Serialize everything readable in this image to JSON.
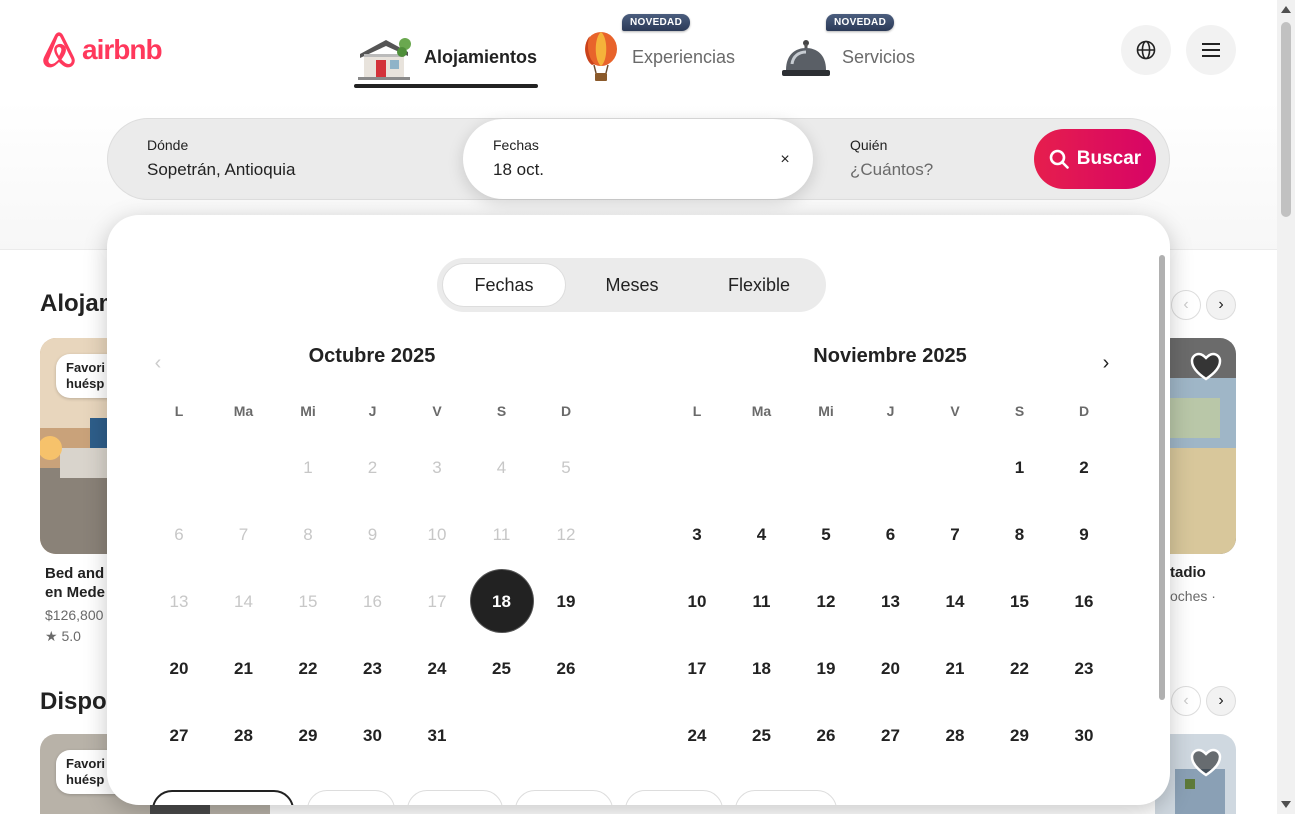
{
  "brand": {
    "name": "airbnb",
    "color": "#FF385C"
  },
  "nav": {
    "items": [
      {
        "label": "Alojamientos",
        "icon": "house-icon",
        "active": true
      },
      {
        "label": "Experiencias",
        "icon": "hot-air-balloon-icon",
        "badge": "NOVEDAD"
      },
      {
        "label": "Servicios",
        "icon": "service-bell-icon",
        "badge": "NOVEDAD"
      }
    ]
  },
  "header_actions": {
    "globe": "globe-icon",
    "menu": "hamburger-menu-icon"
  },
  "search": {
    "where_label": "Dónde",
    "where_value": "Sopetrán, Antioquia",
    "dates_label": "Fechas",
    "dates_value": "18 oct.",
    "clear": "×",
    "who_label": "Quién",
    "who_placeholder": "¿Cuántos?",
    "button_label": "Buscar",
    "button_color": "#E61E4D"
  },
  "background": {
    "section1_title": "Alojam",
    "section2_title": "Dispor",
    "card1": {
      "badge_line1": "Favori",
      "badge_line2": "huésp",
      "title_line1": "Bed and",
      "title_line2": "en Mede",
      "price": "$126,800",
      "rating": "★ 5.0"
    },
    "card2": {
      "badge_line1": "Favori",
      "badge_line2": "huésp"
    },
    "right_card": {
      "title": "tadio",
      "subtitle": "oches ·"
    }
  },
  "calendar": {
    "tabs": [
      "Fechas",
      "Meses",
      "Flexible"
    ],
    "active_tab": 0,
    "weekdays": [
      "L",
      "Ma",
      "Mi",
      "J",
      "V",
      "S",
      "D"
    ],
    "months": [
      {
        "title": "Octubre 2025",
        "offset": 2,
        "days": 31,
        "past_until": 17,
        "selected": 18
      },
      {
        "title": "Noviembre 2025",
        "offset": 5,
        "days": 30,
        "past_until": 0,
        "selected": 0
      }
    ],
    "prev_arrow": "‹",
    "next_arrow": "›"
  }
}
